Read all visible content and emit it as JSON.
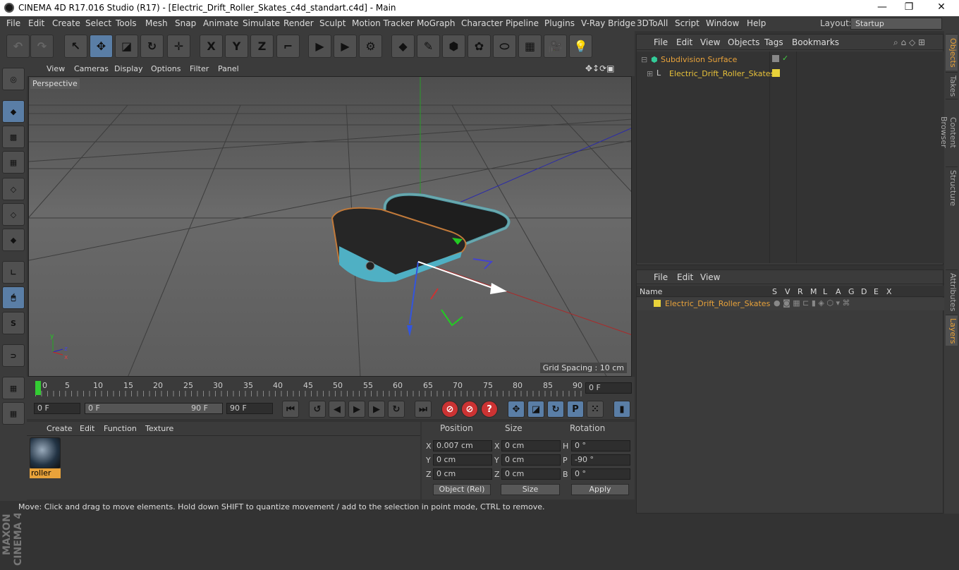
{
  "window": {
    "title": "CINEMA 4D R17.016 Studio (R17) - [Electric_Drift_Roller_Skates_c4d_standart.c4d] - Main",
    "minimize": "—",
    "maximize": "❐",
    "close": "✕"
  },
  "menubar": {
    "items": [
      "File",
      "Edit",
      "Create",
      "Select",
      "Tools",
      "Mesh",
      "Snap",
      "Animate",
      "Simulate",
      "Render",
      "Sculpt",
      "Motion Tracker",
      "MoGraph",
      "Character",
      "Pipeline",
      "Plugins",
      "V-Ray Bridge",
      "3DToAll",
      "Script",
      "Window",
      "Help"
    ],
    "layout_label": "Layout:",
    "layout_value": "Startup"
  },
  "toolbar": {
    "x_axis": "X",
    "y_axis": "Y",
    "z_axis": "Z"
  },
  "viewport": {
    "menu": [
      "View",
      "Cameras",
      "Display",
      "Options",
      "Filter",
      "Panel"
    ],
    "camera_label": "Perspective",
    "grid_spacing": "Grid Spacing : 10 cm"
  },
  "timeline": {
    "ticks": [
      "0",
      "5",
      "10",
      "15",
      "20",
      "25",
      "30",
      "35",
      "40",
      "45",
      "50",
      "55",
      "60",
      "65",
      "70",
      "75",
      "80",
      "85",
      "90"
    ],
    "current_frame": "0 F",
    "start_frame": "0 F",
    "range_start": "0 F",
    "range_end": "90 F",
    "end_frame": "90 F"
  },
  "material_panel": {
    "menu": [
      "Create",
      "Edit",
      "Function",
      "Texture"
    ],
    "material_name": "roller"
  },
  "coord_panel": {
    "headers": [
      "Position",
      "Size",
      "Rotation"
    ],
    "position": {
      "x": "0.007 cm",
      "y": "0 cm",
      "z": "0 cm"
    },
    "size": {
      "x": "0 cm",
      "y": "0 cm",
      "z": "0 cm"
    },
    "rotation": {
      "h": "0 °",
      "p": "-90 °",
      "b": "0 °"
    },
    "labels": {
      "x": "X",
      "y": "Y",
      "z": "Z",
      "h": "H",
      "p": "P",
      "b": "B"
    },
    "mode": "Object (Rel)",
    "size_mode": "Size",
    "apply": "Apply"
  },
  "status": {
    "text": "Move: Click and drag to move elements. Hold down SHIFT to quantize movement / add to the selection in point mode, CTRL to remove."
  },
  "object_manager": {
    "menu": [
      "File",
      "Edit",
      "View",
      "Objects",
      "Tags",
      "Bookmarks"
    ],
    "objects": [
      {
        "name": "Subdivision Surface",
        "color": "#e8a23a"
      },
      {
        "name": "Electric_Drift_Roller_Skates",
        "color": "#e8c23a"
      }
    ]
  },
  "side_tabs": [
    "Objects",
    "Takes",
    "Content Browser",
    "Structure",
    "Attributes",
    "Layers"
  ],
  "layer_manager": {
    "menu": [
      "File",
      "Edit",
      "View"
    ],
    "columns": [
      "Name",
      "S",
      "V",
      "R",
      "M",
      "L",
      "A",
      "G",
      "D",
      "E",
      "X"
    ],
    "layer_name": "Electric_Drift_Roller_Skates"
  },
  "logo": {
    "text": "MAXON CINEMA 4D"
  },
  "colors": {
    "accent": "#e8a23a",
    "blue_button": "#5a7ea6",
    "panel": "#3b3b3b"
  }
}
